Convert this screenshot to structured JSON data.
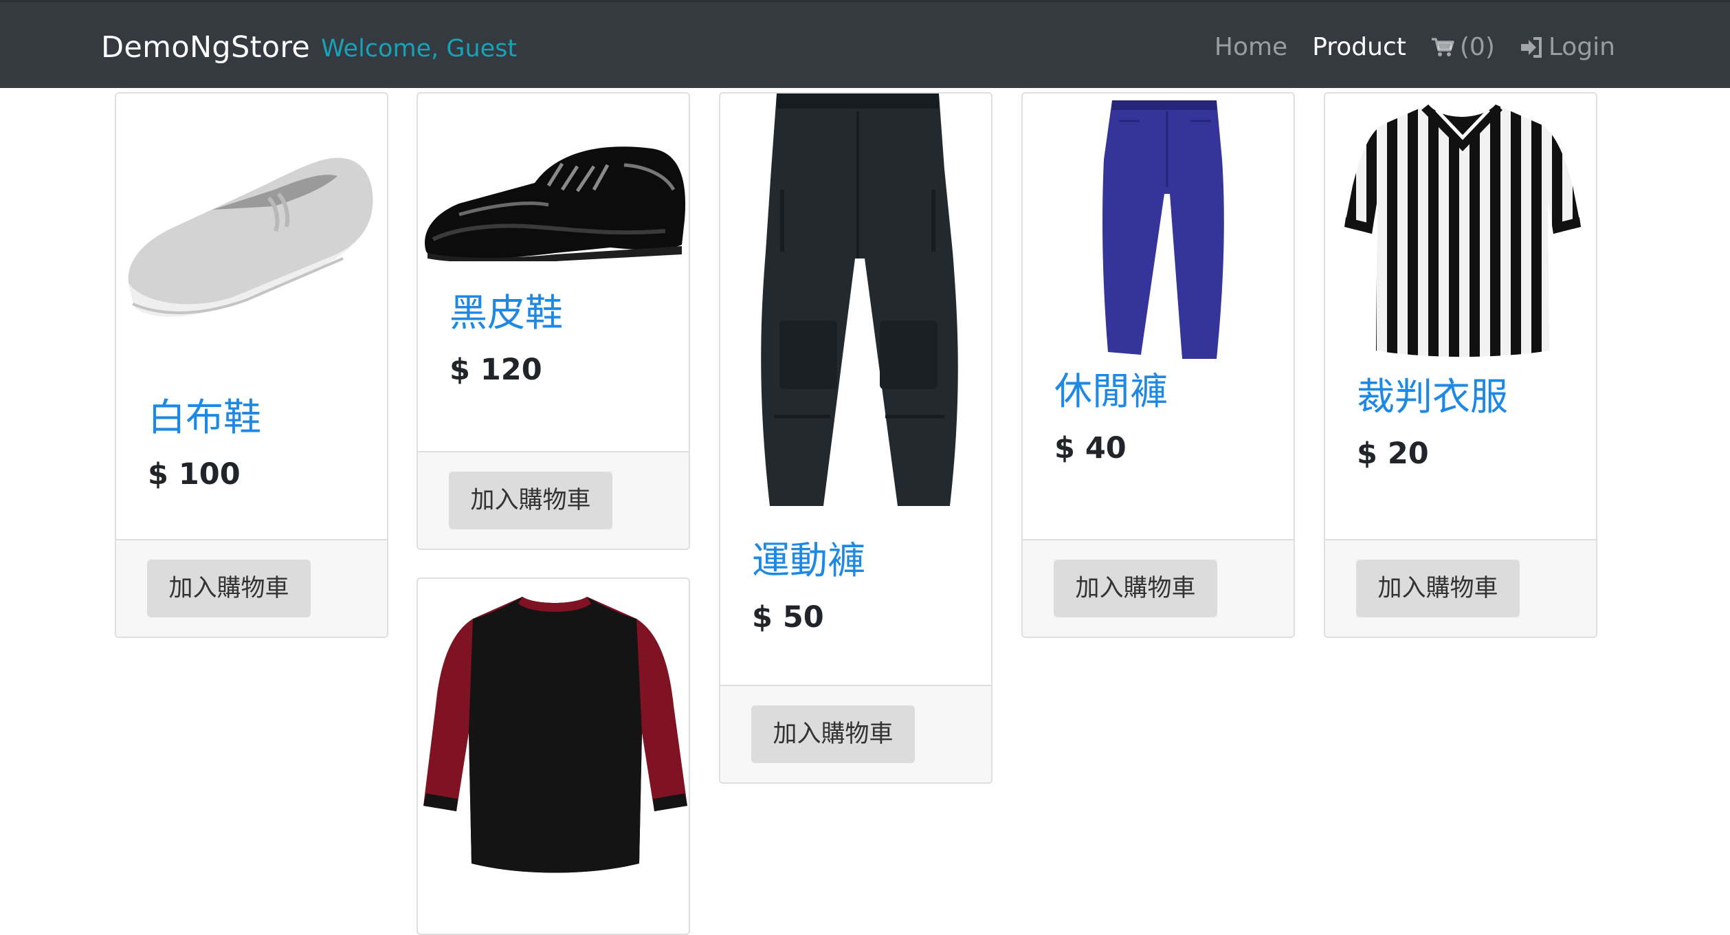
{
  "navbar": {
    "brand": "DemoNgStore",
    "welcome": "Welcome, Guest",
    "links": {
      "home": "Home",
      "product": "Product",
      "cart": "(0)",
      "login": "Login"
    }
  },
  "products": [
    {
      "name": "白布鞋",
      "price": "$ 100",
      "button": "加入購物車",
      "image": "white-canvas-shoe"
    },
    {
      "name": "黑皮鞋",
      "price": "$ 120",
      "button": "加入購物車",
      "image": "black-leather-shoe"
    },
    {
      "name": "運動褲",
      "price": "$ 50",
      "button": "加入購物車",
      "image": "black-cargo-pants"
    },
    {
      "name": "休閒褲",
      "price": "$ 40",
      "button": "加入購物車",
      "image": "blue-casual-pants"
    },
    {
      "name": "裁判衣服",
      "price": "$ 20",
      "button": "加入購物車",
      "image": "referee-striped-shirt"
    },
    {
      "image": "raglan-baseball-tee"
    }
  ],
  "colors": {
    "navbar": "#343a40",
    "welcome": "#17a2b8",
    "title": "#1e88e5",
    "button": "#dcdcdc"
  }
}
